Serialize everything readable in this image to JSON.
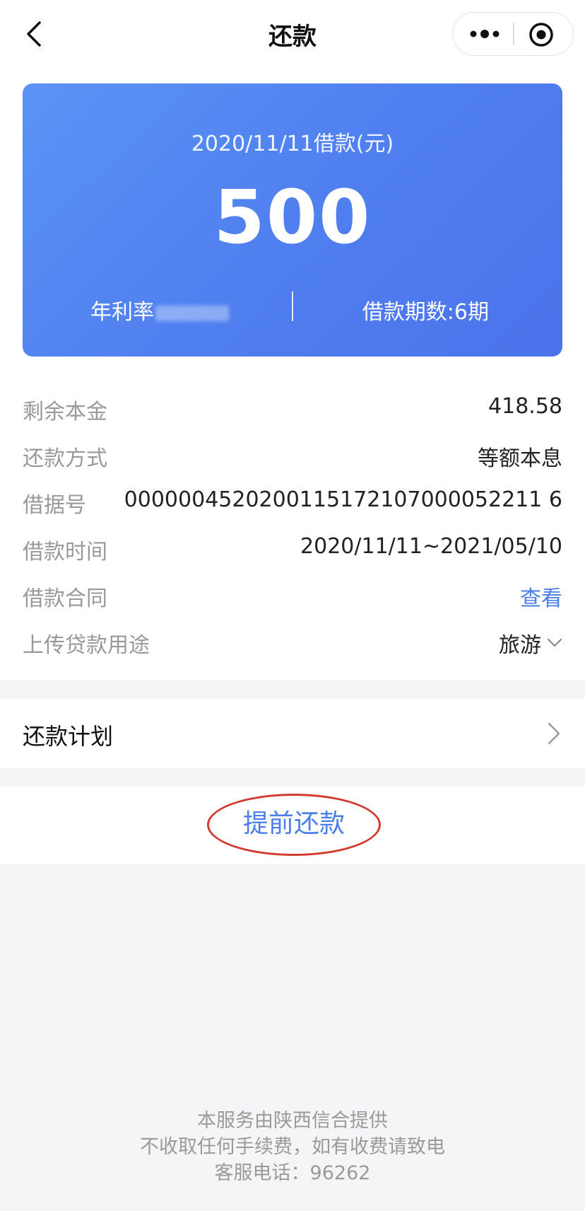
{
  "nav": {
    "title": "还款",
    "back_icon": "chevron-left-icon",
    "more_icon": "more-dots-icon",
    "close_icon": "target-icon"
  },
  "card": {
    "date_label": "2020/11/11借款(元)",
    "amount": "500",
    "rate_label": "年利率",
    "periods_label": "借款期数:6期"
  },
  "details": {
    "remaining_principal": {
      "label": "剩余本金",
      "value": "418.58"
    },
    "repay_method": {
      "label": "还款方式",
      "value": "等额本息"
    },
    "receipt_no": {
      "label": "借据号",
      "value": "0000004520200115172107000052211 6"
    },
    "loan_period": {
      "label": "借款时间",
      "value": "2020/11/11~2021/05/10"
    },
    "contract": {
      "label": "借款合同",
      "value": "查看"
    },
    "purpose": {
      "label": "上传贷款用途",
      "value": "旅游"
    }
  },
  "plan": {
    "label": "还款计划"
  },
  "prepay": {
    "label": "提前还款"
  },
  "footer": {
    "line1": "本服务由陕西信合提供",
    "line2": "不收取任何手续费，如有收费请致电",
    "line3": "客服电话：96262"
  },
  "colors": {
    "accent_blue": "#4a7ee8",
    "card_gradient_start": "#5b93f5",
    "card_gradient_end": "#4b73ec",
    "annotation_red": "#d33a2f"
  }
}
